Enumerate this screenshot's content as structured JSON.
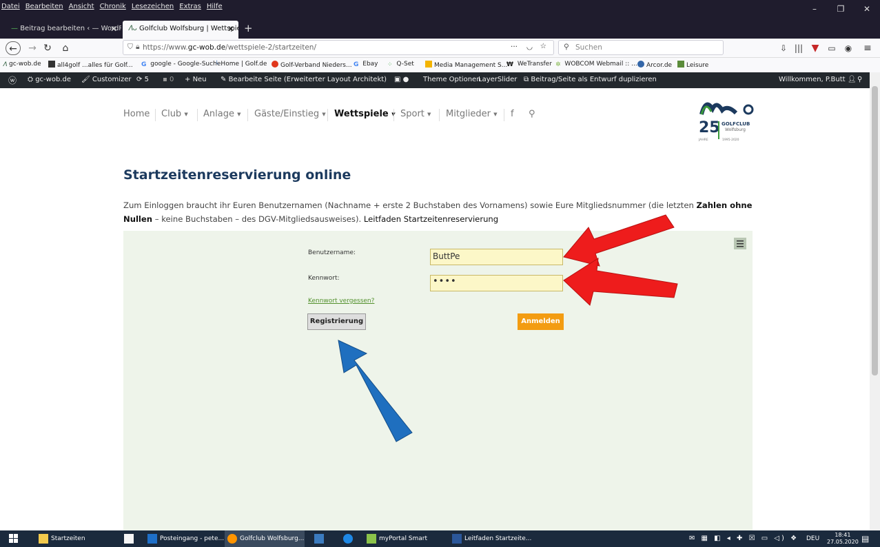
{
  "menubar": {
    "items": [
      "Datei",
      "Bearbeiten",
      "Ansicht",
      "Chronik",
      "Lesezeichen",
      "Extras",
      "Hilfe"
    ]
  },
  "tabs": [
    {
      "label": "Beitrag bearbeiten ‹ — WordPr"
    },
    {
      "label": "Golfclub Wolfsburg | Wettspiel"
    }
  ],
  "navbar": {
    "url_prefix": "https://www.",
    "url_domain": "gc-wob.de",
    "url_path": "/wettspiele-2/startzeiten/",
    "search_placeholder": "Suchen",
    "more": "···"
  },
  "bookmarks": [
    "gc-wob.de",
    "all4golf ...alles für Golf...",
    "google - Google-Suche",
    "Home | Golf.de",
    "Golf-Verband Nieders...",
    "Ebay",
    "Q-Set",
    "Media Management S...",
    "WeTransfer",
    "WOBCOM Webmail :: ...",
    "Arcor.de",
    "Leisure"
  ],
  "adminbar": {
    "site": "gc-wob.de",
    "customizer": "Customizer",
    "updates": "5",
    "comments": "0",
    "new": "Neu",
    "edit": "Bearbeite Seite (Erweiterter Layout Architekt)",
    "theme": "Theme Optionen",
    "slider": "LayerSlider",
    "duplicate": "Beitrag/Seite als Entwurf duplizieren",
    "welcome": "Willkommen, P.Butt"
  },
  "sitenav": {
    "items": [
      "Home",
      "Club",
      "Anlage",
      "Gäste/Einstieg",
      "Wettspiele",
      "Sport",
      "Mitglieder",
      "f"
    ],
    "dropdown_marker": "▾"
  },
  "logo": {
    "big": "25",
    "club": "GOLFCLUB",
    "city": "Wolfsburg",
    "jahre": "JAHRE",
    "years": "1995-2020"
  },
  "main": {
    "heading": "Startzeitenreservierung online",
    "intro_1": "Zum Einloggen braucht ihr Euren Benutzernamen (Nachname + erste 2 Buchstaben des Vornamens) sowie Eure Mitgliedsnummer (die letzten ",
    "intro_bold": "Zahlen ohne Nullen",
    "intro_2": " – keine Buchstaben – des DGV-Mitgliedsausweises). ",
    "intro_link": "Leitfaden Startzeitenreservierung"
  },
  "form": {
    "user_label": "Benutzername:",
    "user_value": "ButtPe",
    "pass_label": "Kennwort:",
    "pass_value": "••••",
    "forgot": "Kennwort vergessen?",
    "register": "Registrierung",
    "login": "Anmelden"
  },
  "taskbar": {
    "items": [
      "Startzeiten",
      "Posteingang - pete...",
      "Golfclub Wolfsburg...",
      "myPortal Smart",
      "Leitfaden Startzeite..."
    ],
    "lang": "DEU",
    "time": "18:41",
    "date": "27.05.2020"
  },
  "colors": {
    "heading": "#1c3a5e",
    "panel": "#eef4ea",
    "login": "#f39c12",
    "arrow_red": "#ee1c1c",
    "arrow_blue": "#1f6fbf"
  }
}
